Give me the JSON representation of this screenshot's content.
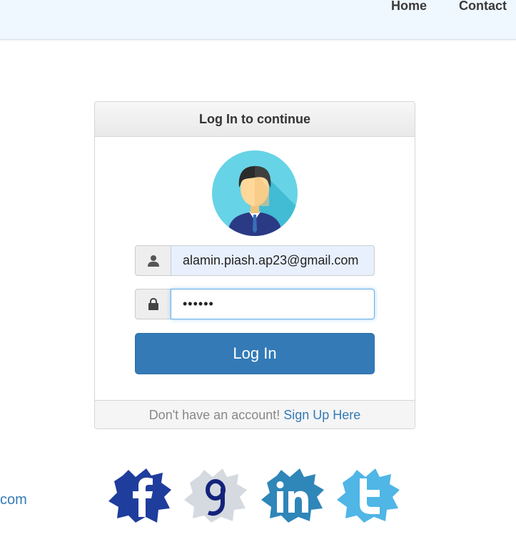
{
  "nav": {
    "home": "Home",
    "contact": "Contact"
  },
  "panel": {
    "title": "Log In to continue",
    "email_value": "alamin.piash.ap23@gmail.com",
    "password_value": "••••••",
    "login_button": "Log In",
    "footer_text": "Don't have an account! ",
    "footer_link": "Sign Up Here"
  },
  "partial_link": "com",
  "social": [
    "facebook-icon",
    "google-icon",
    "linkedin-icon",
    "twitter-icon"
  ],
  "colors": {
    "primary": "#337ab7",
    "nav_bg": "#eff7ff",
    "email_bg": "#e8f0fe"
  }
}
